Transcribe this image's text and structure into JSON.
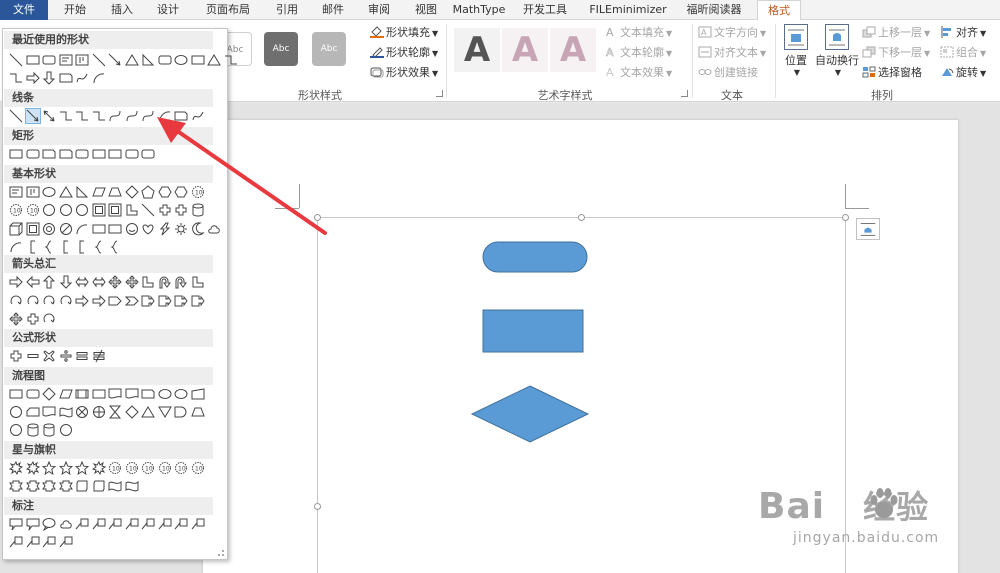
{
  "tabs": {
    "file": "文件",
    "home": "开始",
    "insert": "插入",
    "design": "设计",
    "layout": "页面布局",
    "references": "引用",
    "mailings": "邮件",
    "review": "审阅",
    "view": "视图",
    "mathtype": "MathType",
    "developer": "开发工具",
    "fileminimizer": "FILEminimizer",
    "foxit": "福昕阅读器",
    "format": "格式"
  },
  "ribbon": {
    "shape_style_label": "形状样式",
    "wordart_label": "艺术字样式",
    "text_label": "文本",
    "arrange_label": "排列",
    "style_previews": [
      "Abc",
      "Abc",
      "Abc"
    ],
    "shape_fill": "形状填充",
    "shape_outline": "形状轮廓",
    "shape_effects": "形状效果",
    "wordart_letters": [
      "A",
      "A",
      "A"
    ],
    "text_fill": "文本填充",
    "text_outline": "文本轮廓",
    "text_effects": "文本效果",
    "text_direction": "文字方向",
    "align_text": "对齐文本",
    "create_link": "创建链接",
    "position": "位置",
    "wrap_text": "自动换行",
    "bring_forward": "上移一层",
    "send_backward": "下移一层",
    "selection_pane": "选择窗格",
    "align": "对齐",
    "group": "组合",
    "rotate": "旋转"
  },
  "dropdown": {
    "sections": [
      "最近使用的形状",
      "线条",
      "矩形",
      "基本形状",
      "箭头总汇",
      "公式形状",
      "流程图",
      "星与旗帜",
      "标注"
    ]
  },
  "colors": {
    "file_tab": "#2b579a",
    "active_tab_text": "#c1571c",
    "shape_fill": "#5b9bd5",
    "shape_stroke": "#41719c",
    "arrow": "#e8393f"
  },
  "watermark": {
    "brand": "Bai",
    "brand_cn": "经验",
    "sub": "jingyan.baidu.com"
  }
}
